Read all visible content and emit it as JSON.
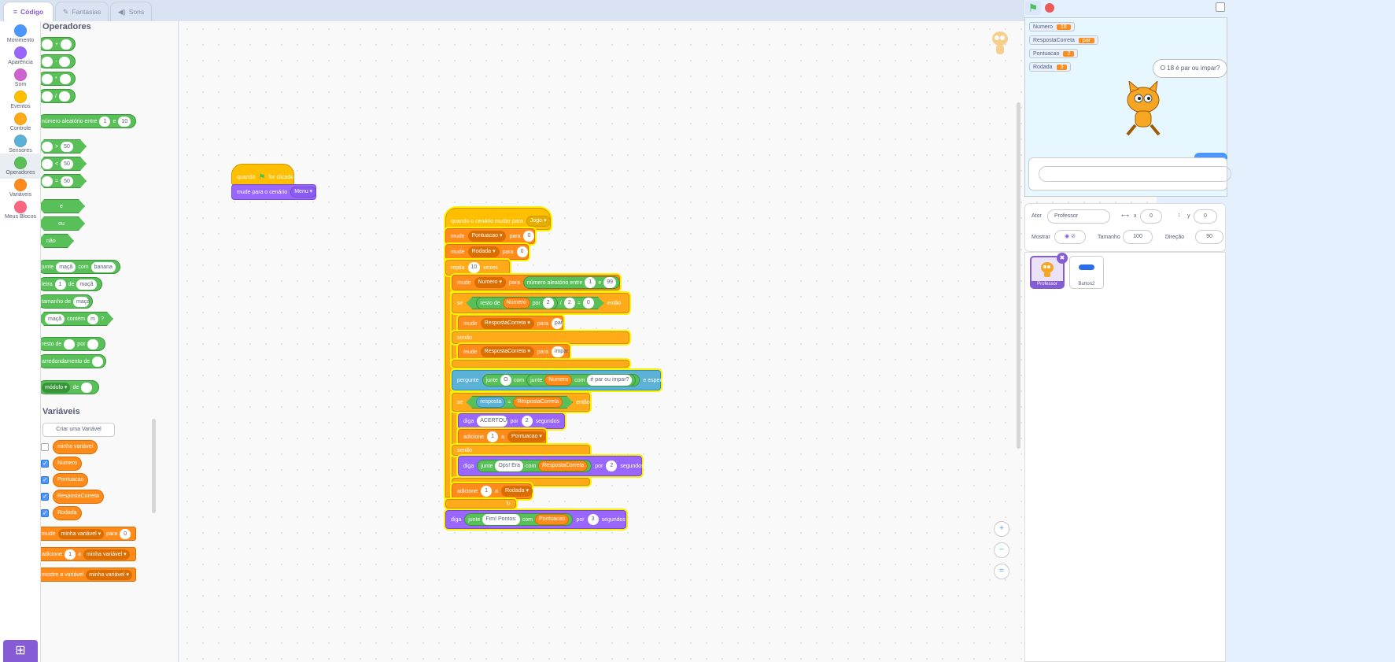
{
  "tabs": {
    "code": "Código",
    "costumes": "Fantasias",
    "sounds": "Sons"
  },
  "categories": [
    {
      "label": "Movimento",
      "color": "#4c97ff"
    },
    {
      "label": "Aparência",
      "color": "#9966ff"
    },
    {
      "label": "Som",
      "color": "#cf63cf"
    },
    {
      "label": "Eventos",
      "color": "#ffbf00"
    },
    {
      "label": "Controle",
      "color": "#ffab19"
    },
    {
      "label": "Sensores",
      "color": "#5cb1d6"
    },
    {
      "label": "Operadores",
      "color": "#59c059"
    },
    {
      "label": "Variáveis",
      "color": "#ff8c1a"
    },
    {
      "label": "Meus Blocos",
      "color": "#ff6680"
    }
  ],
  "palette": {
    "operators_heading": "Operadores",
    "ops": [
      "+",
      "-",
      "*",
      "/"
    ],
    "random": {
      "label": "número aleatório entre",
      "a": "1",
      "and": "e",
      "b": "10"
    },
    "compare": [
      ">",
      "<",
      "="
    ],
    "compare_value": "50",
    "logic": [
      "e",
      "ou",
      "não"
    ],
    "join": {
      "label": "junte",
      "a": "maçã",
      "with": "com",
      "b": "banana"
    },
    "letter": {
      "label": "letra",
      "n": "1",
      "of": "de",
      "word": "maçã"
    },
    "length": {
      "label": "tamanho de",
      "word": "maçã"
    },
    "contains": {
      "word": "maçã",
      "label": "contém",
      "ch": "m",
      "q": "?"
    },
    "mod": {
      "label": "resto de",
      "by": "por"
    },
    "round": {
      "label": "arredondamento de"
    },
    "math": {
      "fn": "módulo",
      "of": "de"
    },
    "variables_heading": "Variáveis",
    "create_var": "Criar uma Variável",
    "vars": [
      "minha variável",
      "Numero",
      "Pontuacao",
      "RespostaCorreta",
      "Rodada"
    ],
    "set_block": {
      "label": "mude",
      "var": "minha variável",
      "to": "para",
      "val": "0"
    },
    "change_block": {
      "label": "adicione",
      "val": "1",
      "a": "a",
      "var": "minha variável"
    },
    "show_block": {
      "label": "mostre a variável",
      "var": "minha variável"
    }
  },
  "script1": {
    "hat": "quando",
    "hat2": "for clicado",
    "look": "mude para o cenário",
    "backdrop": "Menu"
  },
  "script2": {
    "hat": "quando o cenário mudar para",
    "hat_val": "Jogo",
    "set1": {
      "label": "mude",
      "var": "Pontuacao",
      "to": "para",
      "val": "0"
    },
    "set2": {
      "label": "mude",
      "var": "Rodada",
      "to": "para",
      "val": "0"
    },
    "repeat": {
      "label": "repita",
      "n": "10",
      "times": "vezes"
    },
    "set3": {
      "label": "mude",
      "var": "Numero",
      "to": "para",
      "rand": "número aleatório entre",
      "a": "1",
      "and": "e",
      "b": "99"
    },
    "if1": {
      "label": "se",
      "mod": "resto de",
      "var": "Numero",
      "by": "por",
      "d": "2",
      "slash": "/",
      "d2": "2",
      "eq": "=",
      "z": "0",
      "then": "então"
    },
    "set4": {
      "label": "mude",
      "var": "RespostaCorreta",
      "to": "para",
      "val": "par"
    },
    "else1": "senão",
    "set5": {
      "label": "mude",
      "var": "RespostaCorreta",
      "to": "para",
      "val": "impar"
    },
    "ask": {
      "label": "pergunte",
      "join": "junte",
      "o": "O",
      "with": "com",
      "join2": "junte",
      "var": "Numero",
      "with2": "com",
      "q": "é par ou impar?",
      "wait": "e espere"
    },
    "if2": {
      "label": "se",
      "answer": "resposta",
      "eq": "=",
      "var": "RespostaCorreta",
      "then": "então"
    },
    "say1": {
      "label": "diga",
      "msg": "ACERTOU!",
      "for": "por",
      "secs": "2",
      "unit": "segundos"
    },
    "change1": {
      "label": "adicione",
      "val": "1",
      "a": "a",
      "var": "Pontuacao"
    },
    "else2": "senão",
    "say2": {
      "label": "diga",
      "join": "junte",
      "msg": "Ops! Era",
      "with": "com",
      "var": "RespostaCorreta",
      "for": "por",
      "secs": "2",
      "unit": "segundos"
    },
    "change2": {
      "label": "adicione",
      "val": "1",
      "a": "a",
      "var": "Rodada"
    },
    "say3": {
      "label": "diga",
      "join": "junte",
      "msg": "Fim! Pontos:",
      "with": "com",
      "var": "Pontuacao",
      "for": "por",
      "secs": "3",
      "unit": "segundos"
    }
  },
  "monitors": [
    {
      "name": "Numero",
      "value": "18"
    },
    {
      "name": "RespostaCorreta",
      "value": "par"
    },
    {
      "name": "Pontuacao",
      "value": "2"
    },
    {
      "name": "Rodada",
      "value": "3"
    }
  ],
  "speech": "O 18 é par ou impar?",
  "sprite_info": {
    "sprite_label": "Ator",
    "sprite_name": "Professor",
    "x_label": "x",
    "x": "0",
    "y_label": "y",
    "y": "0",
    "show_label": "Mostrar",
    "size_label": "Tamanho",
    "size": "100",
    "dir_label": "Direção",
    "dir": "90"
  },
  "sprites": [
    {
      "name": "Professor"
    },
    {
      "name": "Button2"
    }
  ]
}
